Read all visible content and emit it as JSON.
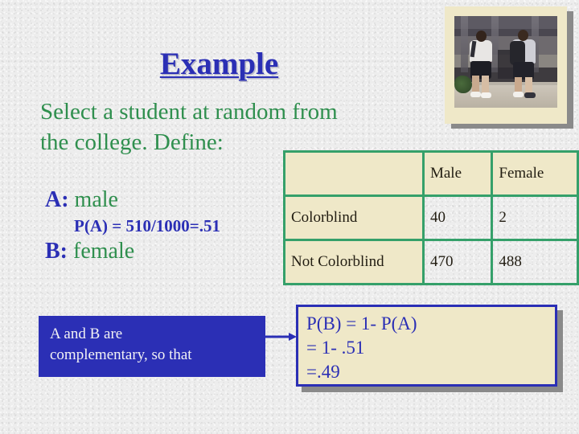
{
  "slide": {
    "title": "Example",
    "colors": {
      "title_blue": "#2b2fb5",
      "body_green": "#2f8f4e",
      "table_border_green": "#35a06a",
      "cream": "#efe8c8",
      "background": "#ededed"
    }
  },
  "photo": {
    "alt": "two students walking on campus"
  },
  "body": {
    "intro_line1": "Select a student at random from",
    "intro_line2": "the college. Define:",
    "event_a_label": "A:",
    "event_a_text": "male",
    "p_a_line": "P(A) = 510/1000=.51",
    "event_b_label": "B:",
    "event_b_text": "female"
  },
  "table": {
    "corner": "",
    "columns": [
      "Male",
      "Female"
    ],
    "rows": [
      {
        "label": "Colorblind",
        "male": "40",
        "female": "2"
      },
      {
        "label": "Not Colorblind",
        "male": "470",
        "female": "488"
      }
    ]
  },
  "callout": {
    "line1": "A and B are",
    "line2": "complementary, so that"
  },
  "result": {
    "line1": "P(B) = 1- P(A)",
    "line2": "= 1- .51",
    "line3": "=.49"
  }
}
